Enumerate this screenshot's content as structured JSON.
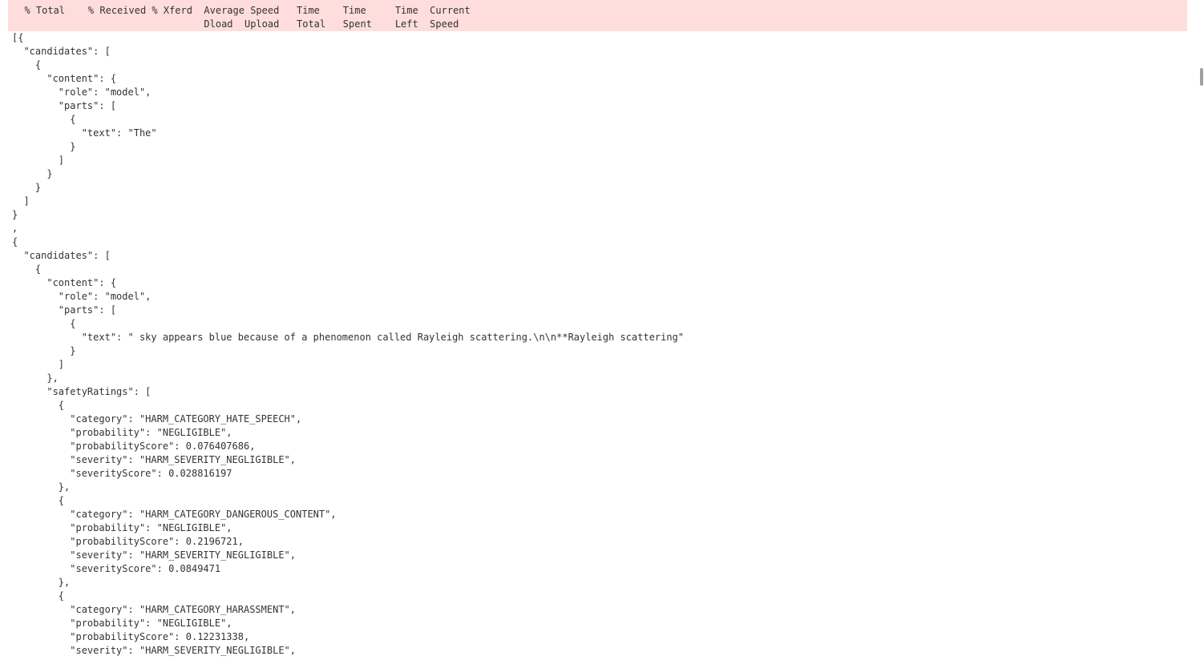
{
  "progress_header": {
    "lines": [
      "  % Total    % Received % Xferd  Average Speed   Time    Time     Time  Current",
      "                                 Dload  Upload   Total   Spent    Left  Speed"
    ]
  },
  "response_output": {
    "lines": [
      "[{",
      "  \"candidates\": [",
      "    {",
      "      \"content\": {",
      "        \"role\": \"model\",",
      "        \"parts\": [",
      "          {",
      "            \"text\": \"The\"",
      "          }",
      "        ]",
      "      }",
      "    }",
      "  ]",
      "}",
      ",",
      "{",
      "  \"candidates\": [",
      "    {",
      "      \"content\": {",
      "        \"role\": \"model\",",
      "        \"parts\": [",
      "          {",
      "            \"text\": \" sky appears blue because of a phenomenon called Rayleigh scattering.\\n\\n**Rayleigh scattering\"",
      "          }",
      "        ]",
      "      },",
      "      \"safetyRatings\": [",
      "        {",
      "          \"category\": \"HARM_CATEGORY_HATE_SPEECH\",",
      "          \"probability\": \"NEGLIGIBLE\",",
      "          \"probabilityScore\": 0.076407686,",
      "          \"severity\": \"HARM_SEVERITY_NEGLIGIBLE\",",
      "          \"severityScore\": 0.028816197",
      "        },",
      "        {",
      "          \"category\": \"HARM_CATEGORY_DANGEROUS_CONTENT\",",
      "          \"probability\": \"NEGLIGIBLE\",",
      "          \"probabilityScore\": 0.2196721,",
      "          \"severity\": \"HARM_SEVERITY_NEGLIGIBLE\",",
      "          \"severityScore\": 0.0849471",
      "        },",
      "        {",
      "          \"category\": \"HARM_CATEGORY_HARASSMENT\",",
      "          \"probability\": \"NEGLIGIBLE\",",
      "          \"probabilityScore\": 0.12231338,",
      "          \"severity\": \"HARM_SEVERITY_NEGLIGIBLE\","
    ]
  },
  "colors": {
    "header_background": "#ffdddd",
    "text": "#333333",
    "scrollbar_thumb": "#a0a0a0"
  }
}
